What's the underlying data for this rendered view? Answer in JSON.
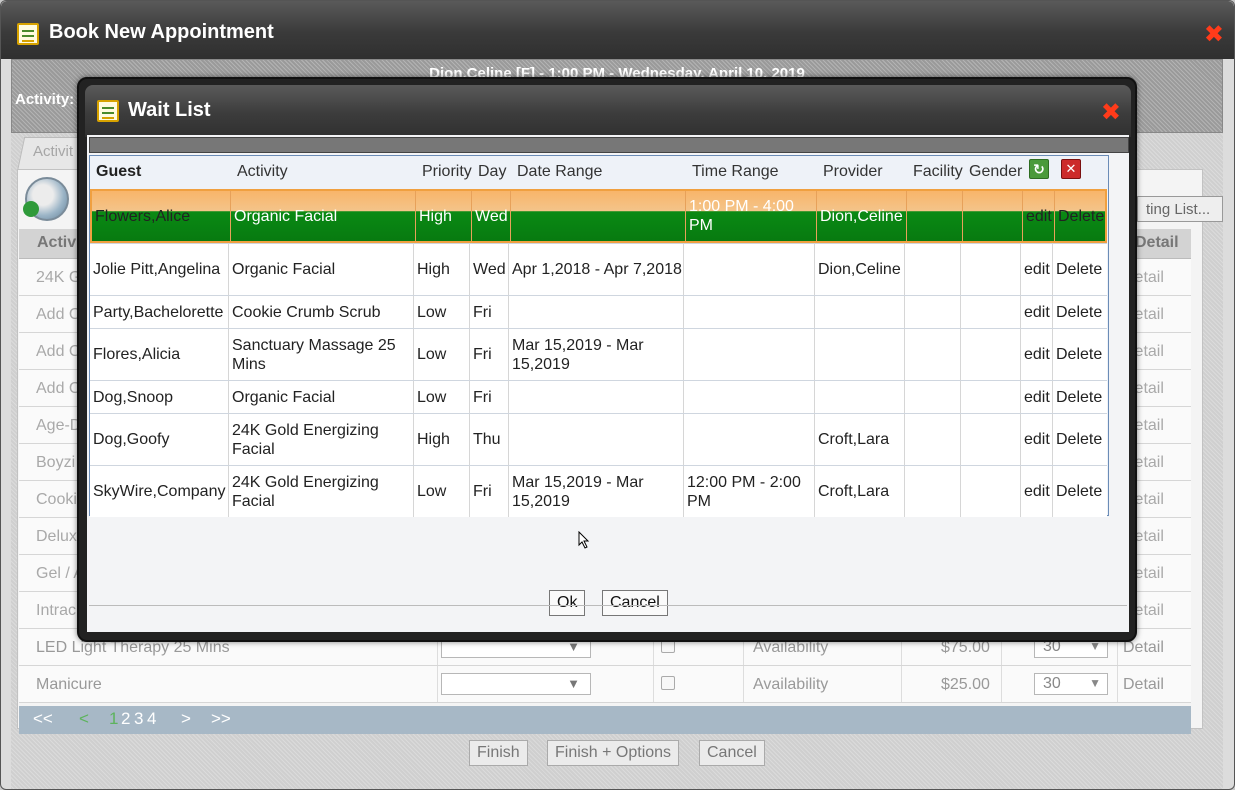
{
  "book_window": {
    "title": "Book New Appointment",
    "appointment_info": "Dion,Celine [F] - 1:00 PM - Wednesday, April 10, 2019",
    "activity_label": "Activity:",
    "tab_label": "Activit",
    "waiting_list_button": "ting List...",
    "table_header_activity": "Activi",
    "table_header_detail": "Detail",
    "rows": [
      {
        "activity": "24K G",
        "detail": "Detail"
      },
      {
        "activity": "Add C",
        "detail": "Detail"
      },
      {
        "activity": "Add C",
        "detail": "Detail"
      },
      {
        "activity": "Add C",
        "detail": "Detail"
      },
      {
        "activity": "Age-D",
        "detail": "Detail"
      },
      {
        "activity": "Boyzi",
        "detail": "Detail"
      },
      {
        "activity": "Cooki",
        "detail": "Detail"
      },
      {
        "activity": "Delux",
        "detail": "Detail"
      },
      {
        "activity": "Gel / A",
        "detail": "Detail"
      },
      {
        "activity": "Intrac",
        "detail": "Detail"
      },
      {
        "activity": "LED Light Therapy 25 Mins",
        "availability": "Availability",
        "price": "$75.00",
        "duration": "30",
        "detail": "Detail"
      },
      {
        "activity": "Manicure",
        "availability": "Availability",
        "price": "$25.00",
        "duration": "30",
        "detail": "Detail"
      }
    ],
    "pager": {
      "first": "<<",
      "prev": "<",
      "pages": [
        "1",
        "2",
        "3",
        "4"
      ],
      "next": ">",
      "last": ">>"
    },
    "buttons": {
      "finish": "Finish",
      "finish_options": "Finish + Options",
      "cancel": "Cancel"
    }
  },
  "wait_list": {
    "title": "Wait List",
    "columns": {
      "guest": "Guest",
      "activity": "Activity",
      "priority": "Priority",
      "day": "Day",
      "date_range": "Date Range",
      "time_range": "Time Range",
      "provider": "Provider",
      "facility": "Facility",
      "gender": "Gender"
    },
    "rows": [
      {
        "guest": "Flowers,Alice",
        "activity": "Organic Facial",
        "priority": "High",
        "day": "Wed",
        "date_range": "",
        "time_range": "1:00 PM - 4:00 PM",
        "provider": "Dion,Celine",
        "edit": "edit",
        "delete": "Delete"
      },
      {
        "guest": "Jolie Pitt,Angelina",
        "activity": "Organic Facial",
        "priority": "High",
        "day": "Wed",
        "date_range": "Apr 1,2018 - Apr 7,2018",
        "time_range": "",
        "provider": "Dion,Celine",
        "edit": "edit",
        "delete": "Delete"
      },
      {
        "guest": "Party,Bachelorette",
        "activity": "Cookie Crumb Scrub",
        "priority": "Low",
        "day": "Fri",
        "date_range": "",
        "time_range": "",
        "provider": "",
        "edit": "edit",
        "delete": "Delete"
      },
      {
        "guest": "Flores,Alicia",
        "activity": "Sanctuary Massage 25 Mins",
        "priority": "Low",
        "day": "Fri",
        "date_range": "Mar 15,2019 - Mar 15,2019",
        "time_range": "",
        "provider": "",
        "edit": "edit",
        "delete": "Delete"
      },
      {
        "guest": "Dog,Snoop",
        "activity": "Organic Facial",
        "priority": "Low",
        "day": "Fri",
        "date_range": "",
        "time_range": "",
        "provider": "",
        "edit": "edit",
        "delete": "Delete"
      },
      {
        "guest": "Dog,Goofy",
        "activity": "24K Gold Energizing Facial",
        "priority": "High",
        "day": "Thu",
        "date_range": "",
        "time_range": "",
        "provider": "Croft,Lara",
        "edit": "edit",
        "delete": "Delete"
      },
      {
        "guest": "SkyWire,Company",
        "activity": "24K Gold Energizing Facial",
        "priority": "Low",
        "day": "Fri",
        "date_range": "Mar 15,2019 - Mar 15,2019",
        "time_range": "12:00 PM - 2:00 PM",
        "provider": "Croft,Lara",
        "edit": "edit",
        "delete": "Delete"
      }
    ],
    "buttons": {
      "ok": "Ok",
      "cancel": "Cancel"
    }
  }
}
